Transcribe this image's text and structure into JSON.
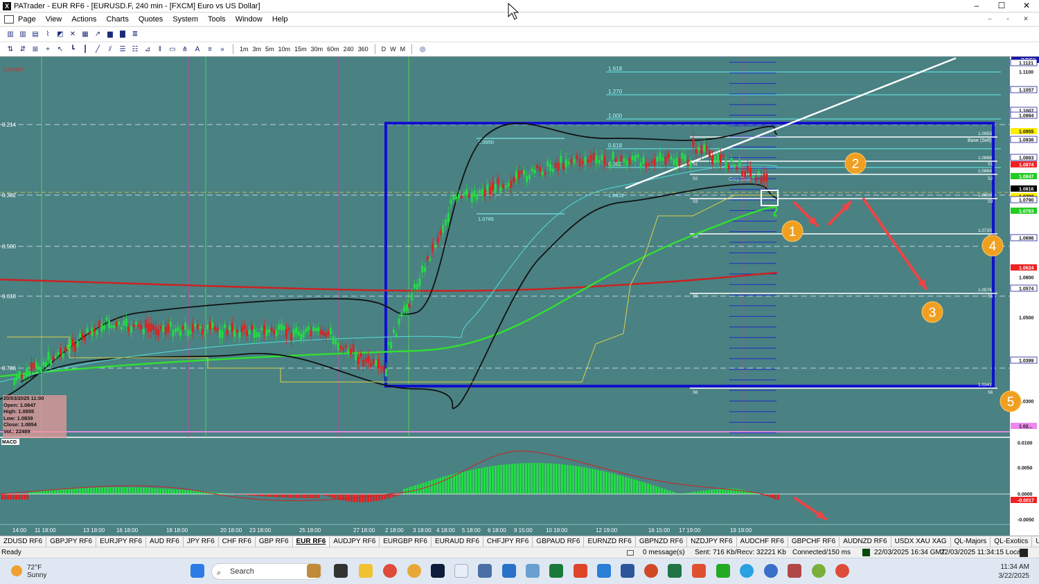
{
  "window": {
    "title": "PATrader - EUR RF6 - [EURUSD.F, 240 min - [FXCM] Euro vs US Dollar]",
    "app_icon_letter": "X",
    "controls": [
      "–",
      "☐",
      "✕"
    ],
    "mdi_controls": [
      "–",
      "▫",
      "✕"
    ]
  },
  "menu": {
    "items": [
      "Page",
      "View",
      "Actions",
      "Charts",
      "Quotes",
      "System",
      "Tools",
      "Window",
      "Help"
    ]
  },
  "toolbar2": {
    "timeframes": [
      "1m",
      "3m",
      "5m",
      "10m",
      "15m",
      "30m",
      "60m",
      "240",
      "360"
    ],
    "periods": [
      "D",
      "W",
      "M"
    ]
  },
  "chart": {
    "locked_label": "Locked",
    "index_label": "INDEX",
    "macd_label": "MACD",
    "left_scale": [
      "0.214",
      "0.382",
      "0.500",
      "0.618",
      "0.786"
    ],
    "fib_labels": [
      "1.618",
      "1.270",
      "1.000",
      "0.618",
      "0.382"
    ],
    "inner_labels": {
      "upper": "1.0950",
      "lower": "1.0765",
      "mid": "1.0822",
      "base_sell": "Base (Sell)",
      "grey": "Grey Base"
    },
    "right_inner_values": [
      "1.0953",
      "1.0888",
      "1.0864",
      "1.0808",
      "1.0720",
      "1.0576",
      "1.0341"
    ],
    "s_labels": [
      "S1",
      "S2",
      "S3",
      "S4",
      "S5",
      "S6"
    ],
    "price_axis": [
      "1.1121",
      "1.1100",
      "1.1057",
      "1.1007",
      "1.0994",
      "1.0955",
      "1.0936",
      "1.0893",
      "1.0874",
      "1.0847",
      "1.0816",
      "1.0798",
      "1.0790",
      "1.0763",
      "1.0696",
      "1.0624",
      "1.0600",
      "1.0574",
      "1.0500",
      "1.0399",
      "1.0300",
      "1.02..."
    ],
    "macd_axis": [
      "0.0100",
      "0.0050",
      "0.0000",
      "-0.0017",
      "-0.0050"
    ],
    "time_axis": [
      "14:00",
      "11 18:00",
      "13 18:00",
      "16 18:00",
      "18 18:00",
      "20 18:00",
      "23 18:00",
      "25 18:00",
      "27 18:00",
      "2 18:00",
      "3 18:00",
      "4 18:00",
      "5 18:00",
      "6 18:00",
      "9 15:00",
      "10 19:00",
      "12 19:00",
      "16 15:00",
      "17 19:00",
      "19 19:00"
    ],
    "annotations": [
      "1",
      "2",
      "3",
      "4",
      "5"
    ],
    "ohlc": {
      "date": "20/03/2025 11:00",
      "open": "Open: 1.0847",
      "high": "High: 1.0855",
      "low": "Low: 1.0839",
      "close": "Close: 1.0854",
      "vol": "Vol.: 22489"
    },
    "colors": {
      "background": "#4a8183",
      "box": "#1010cc",
      "bull": "#22dd44",
      "bear": "#dd2222",
      "ma_long": "#cc2222",
      "ma_green": "#33dd33",
      "annotation": "#f0a020"
    }
  },
  "tabs": {
    "items": [
      "ZDUSD RF6",
      "GBPJPY RF6",
      "EURJPY RF6",
      "AUD RF6",
      "JPY RF6",
      "CHF RF6",
      "GBP RF6",
      "EUR RF6",
      "AUDJPY RF6",
      "EURGBP RF6",
      "EURAUD RF6",
      "CHFJPY RF6",
      "GBPAUD RF6",
      "EURNZD RF6",
      "GBPNZD RF6",
      "NZDJPY RF6",
      "AUDCHF RF6",
      "GBPCHF RF6",
      "AUDNZD RF6",
      "USDX XAU XAG",
      "QL-Majors",
      "QL-Exotics",
      "USDX RF6",
      "Bitcoin",
      "SP500 RF6",
      "DJIA",
      "Lyte"
    ],
    "active_index": 7
  },
  "status": {
    "ready": "Ready",
    "messages": "0 message(s)",
    "traffic": "Sent: 716 Kb/Recv: 32221 Kb",
    "connected": "Connected/150 ms",
    "gmt": "22/03/2025 16:34 GMT",
    "local": "22/03/2025 11:34:15 Local"
  },
  "taskbar": {
    "temperature": "72°F",
    "condition": "Sunny",
    "search_placeholder": "Search",
    "time": "11:34 AM",
    "date": "3/22/2025"
  }
}
